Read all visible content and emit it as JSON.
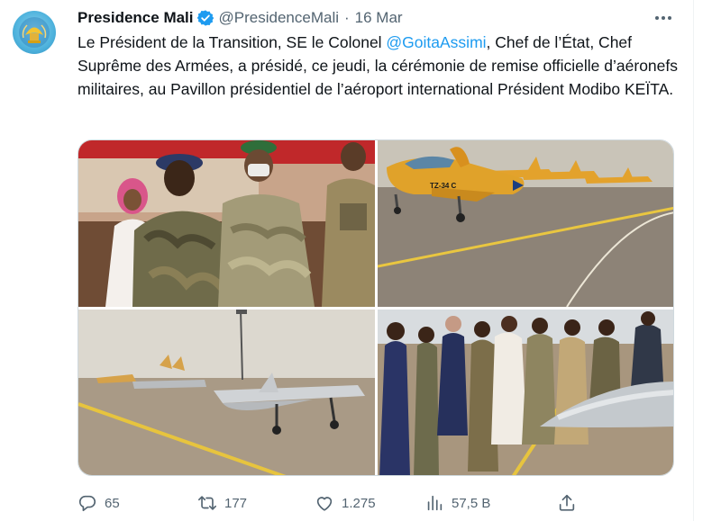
{
  "tweet": {
    "display_name": "Presidence Mali",
    "handle": "@PresidenceMali",
    "separator": "·",
    "date": "16 Mar",
    "text_before": "Le Président de la Transition, SE le Colonel ",
    "mention": "@GoitaAssimi",
    "text_after": ", Chef de l’État, Chef Suprême des Armées, a présidé, ce jeudi, la cérémonie de remise officielle d’aéronefs militaires, au Pavillon présidentiel de l’aéroport international Président Modibo KEÏTA.",
    "photo_label_p2": "TZ-34 C"
  },
  "icons": {
    "avatar": "mali-presidency-seal",
    "verified": "verified-badge-icon",
    "more": "more-horizontal-icon",
    "reply": "reply-icon",
    "retweet": "retweet-icon",
    "like": "heart-icon",
    "views": "views-chart-icon",
    "share": "share-icon"
  },
  "actions": {
    "replies": "65",
    "retweets": "177",
    "likes": "1.275",
    "views": "57,5 B"
  },
  "colors": {
    "accent": "#1d9bf0",
    "text": "#0f1419",
    "secondary": "#536471"
  }
}
